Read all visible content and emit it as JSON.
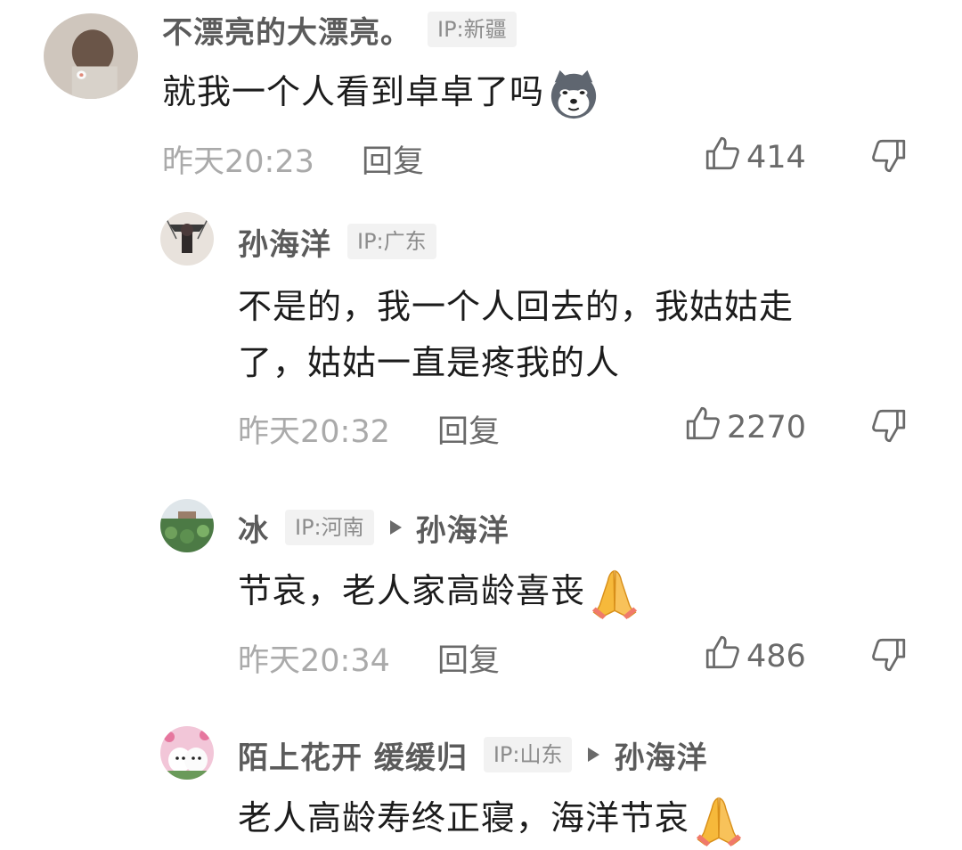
{
  "comments": [
    {
      "user": "不漂亮的大漂亮。",
      "ip": "IP:新疆",
      "reply_to": "",
      "text": "就我一个人看到卓卓了吗",
      "emoji": "husky-dog-emoji",
      "time": "昨天20:23",
      "reply_label": "回复",
      "likes": "414"
    },
    {
      "user": "孙海洋",
      "ip": "IP:广东",
      "reply_to": "",
      "text_line1": "不是的，我一个人回去的，我姑姑走",
      "text_line2": "了，姑姑一直是疼我的人",
      "time": "昨天20:32",
      "reply_label": "回复",
      "likes": "2270"
    },
    {
      "user": "冰",
      "ip": "IP:河南",
      "reply_to": "孙海洋",
      "text": "节哀，老人家高龄喜丧",
      "emoji": "praying-hands-emoji",
      "time": "昨天20:34",
      "reply_label": "回复",
      "likes": "486"
    },
    {
      "user": "陌上花开 缓缓归",
      "ip": "IP:山东",
      "reply_to": "孙海洋",
      "text": "老人高龄寿终正寝，海洋节哀",
      "emoji": "praying-hands-emoji"
    }
  ],
  "icons": {
    "like": "thumbs-up-icon",
    "dislike": "thumbs-down-icon",
    "reply_arrow": "triangle-right-icon"
  },
  "colors": {
    "name": "#5b5b5b",
    "ip_bg": "#f2f2f2",
    "ip_text": "#8c8c8c",
    "time": "#aaaaaa",
    "action": "#6a6a6a",
    "content": "#1c1c1c"
  }
}
